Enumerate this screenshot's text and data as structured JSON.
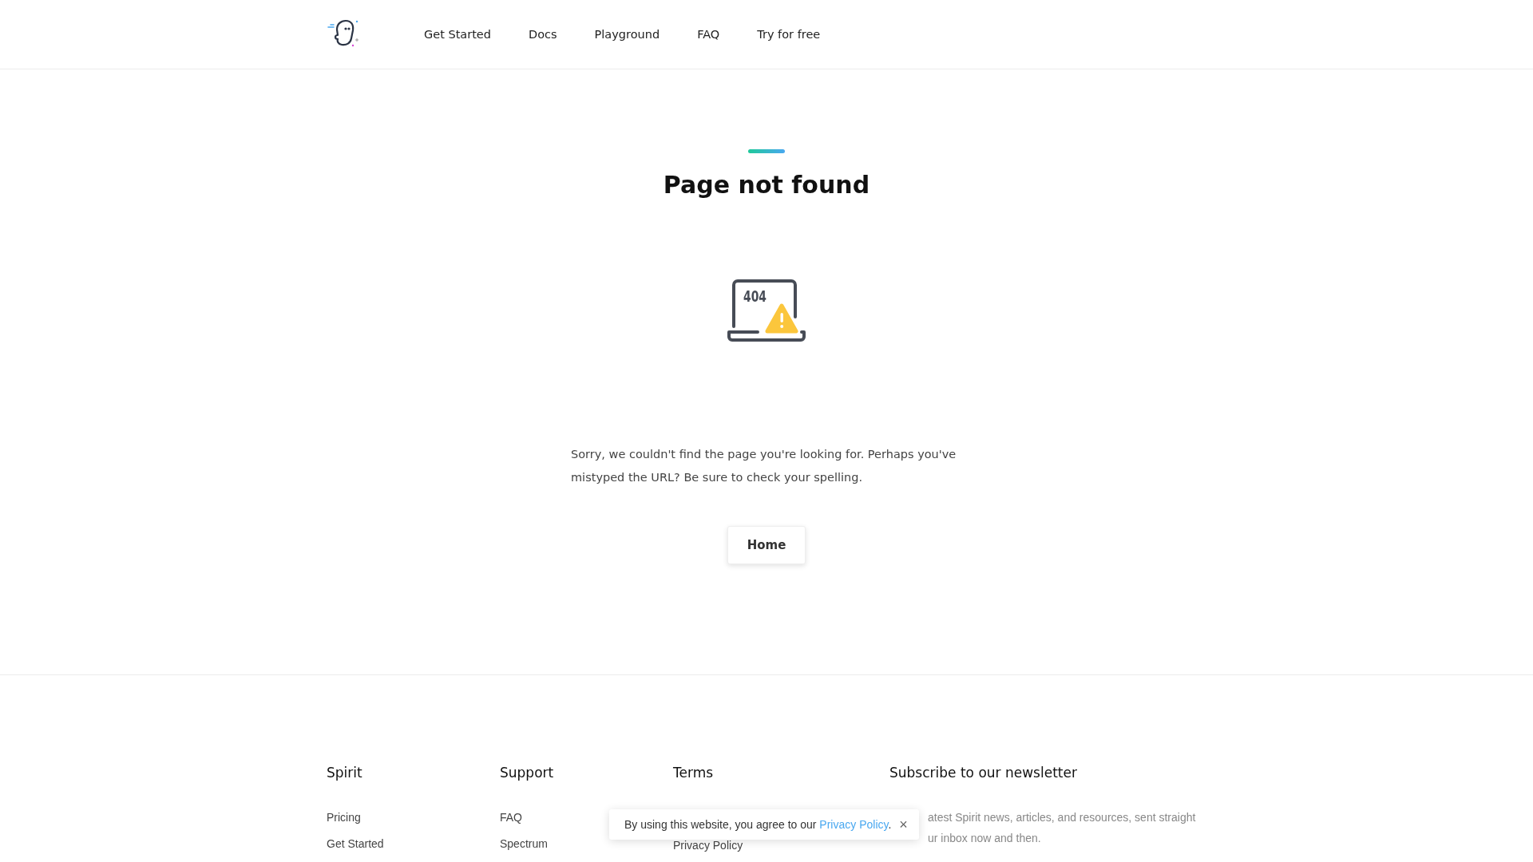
{
  "nav": {
    "links": [
      "Get Started",
      "Docs",
      "Playground",
      "FAQ",
      "Try for free"
    ]
  },
  "main": {
    "title": "Page not found",
    "illustration_text": "404",
    "message": "Sorry, we couldn't find the page you're looking for. Perhaps you've mistyped the URL? Be sure to check your spelling.",
    "button": "Home"
  },
  "footer": {
    "columns": [
      {
        "heading": "Spirit",
        "items": [
          "Pricing",
          "Get Started"
        ]
      },
      {
        "heading": "Support",
        "items": [
          "FAQ",
          "Spectrum"
        ]
      },
      {
        "heading": "Terms",
        "items": [
          "Privacy Policy"
        ]
      }
    ],
    "newsletter": {
      "heading": "Subscribe to our newsletter",
      "lines": [
        "atest Spirit news, articles, and resources, sent straight",
        "ur inbox now and then."
      ]
    }
  },
  "cookie_banner": {
    "text": "By using this website, you agree to our ",
    "link": "Privacy Policy",
    "after": ".",
    "close": "×"
  }
}
